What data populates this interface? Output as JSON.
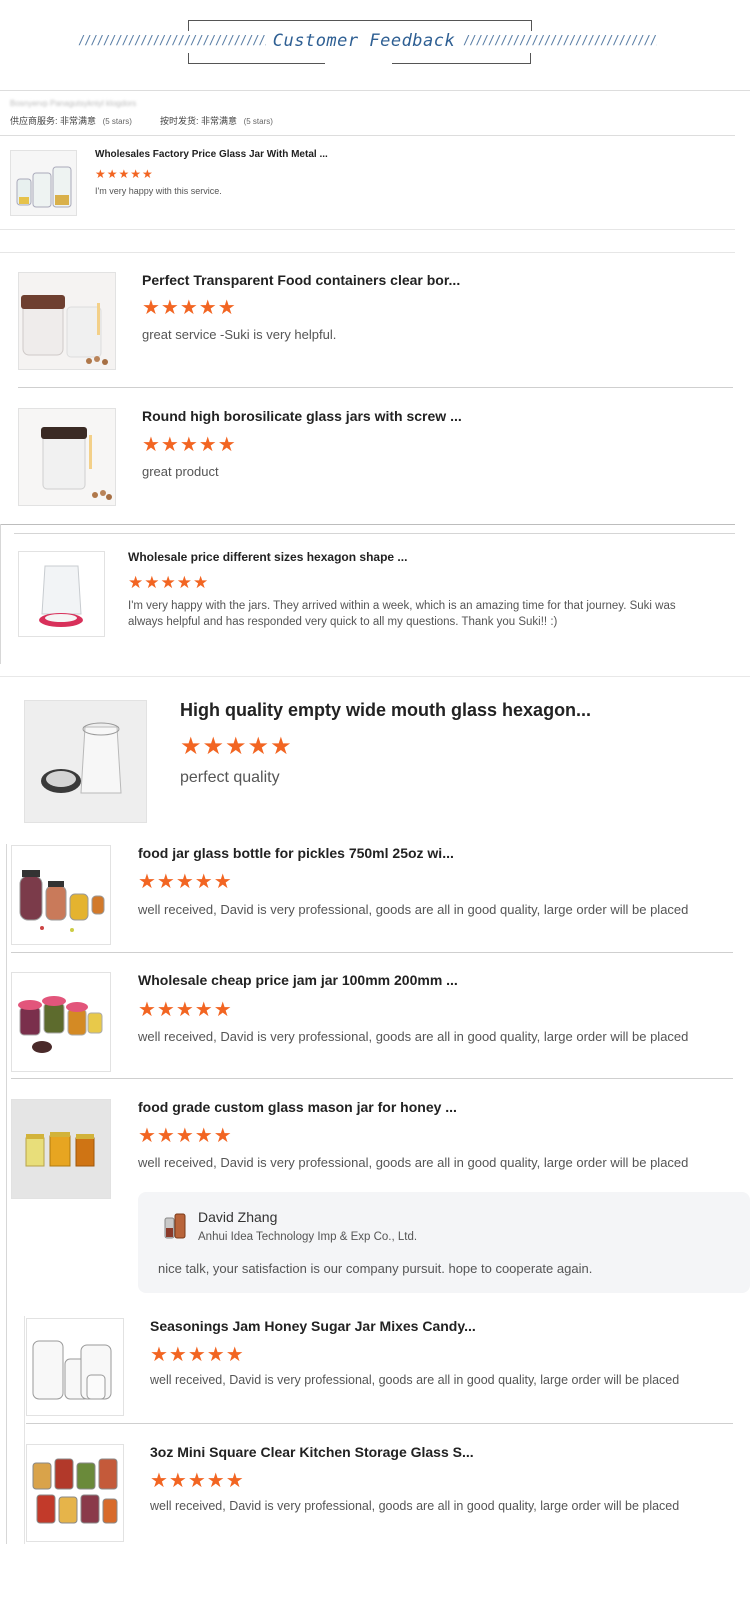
{
  "header": {
    "title": "Customer Feedback",
    "left_slashes": "///////////////////////////////////",
    "right_slashes": "////////////////////////////////////"
  },
  "ratings_bar": {
    "blurred_text": "Bosnyervp Panagutsykniyl klogdors",
    "supplier_service_label": "供应商服务:",
    "supplier_service_value": "非常满意",
    "supplier_service_stars": "(5 stars)",
    "on_time_label": "按时发货:",
    "on_time_value": "非常满意",
    "on_time_stars": "(5 stars)"
  },
  "stars": "★★★★★",
  "reviews": [
    {
      "title": "Wholesales Factory Price Glass Jar With Metal ...",
      "text": "I'm very happy with this service."
    },
    {
      "title": "Perfect Transparent Food containers clear bor...",
      "text": "great service -Suki is very helpful."
    },
    {
      "title": "Round high borosilicate glass jars with screw ...",
      "text": "great product"
    },
    {
      "title": "Wholesale price different sizes hexagon shape ...",
      "text": "I'm very happy with the jars. They arrived within a week, which is an amazing time for that journey. Suki was always helpful and has responded very quick to all my questions. Thank you Suki!! :)"
    },
    {
      "title": "High quality empty wide mouth glass hexagon...",
      "text": "perfect quality"
    },
    {
      "title": "food jar glass bottle for pickles 750ml 25oz wi...",
      "text": "well received, David is very professional, goods are all in good quality, large order will be placed"
    },
    {
      "title": "Wholesale cheap price jam jar 100mm 200mm ...",
      "text": "well received, David is very professional, goods are all in good quality, large order will be placed"
    },
    {
      "title": "food grade custom glass mason jar for honey ...",
      "text": "well received, David is very professional, goods are all in good quality, large order will be placed"
    },
    {
      "title": "Seasonings Jam Honey Sugar Jar Mixes Candy...",
      "text": "well received, David is very professional, goods are all in good quality, large order will be placed"
    },
    {
      "title": "3oz Mini Square Clear Kitchen Storage Glass S...",
      "text": "well received, David is very professional, goods are all in good quality, large order will be placed"
    }
  ],
  "reply": {
    "name": "David Zhang",
    "company": "Anhui Idea Technology Imp & Exp Co., Ltd.",
    "text": "nice talk, your satisfaction is our company pursuit. hope to cooperate again."
  },
  "colors": {
    "star": "#f26522",
    "header_title": "#2e5f93",
    "reply_bg": "#f4f5f7"
  }
}
